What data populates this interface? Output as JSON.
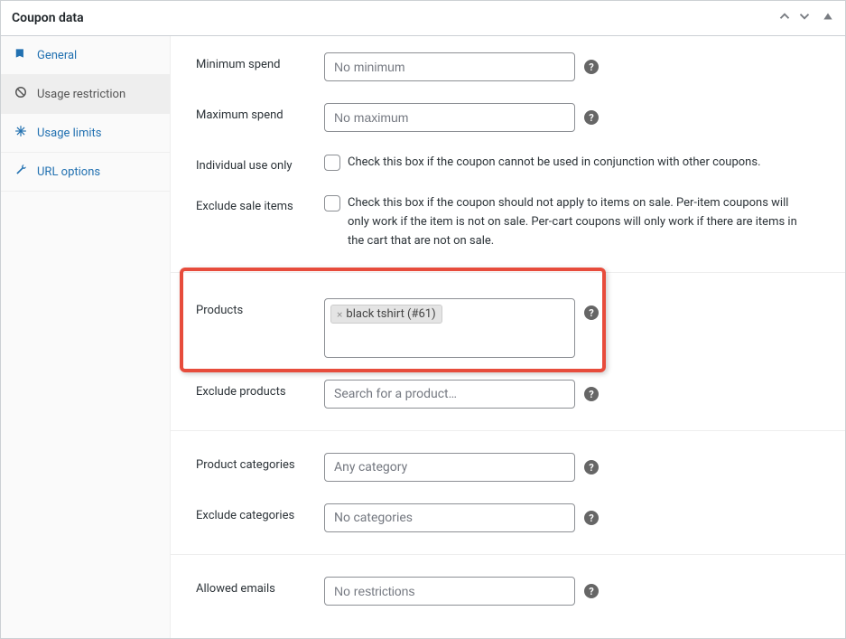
{
  "header": {
    "title": "Coupon data"
  },
  "tabs": [
    {
      "label": "General",
      "icon": "bookmark"
    },
    {
      "label": "Usage restriction",
      "icon": "ban"
    },
    {
      "label": "Usage limits",
      "icon": "spark"
    },
    {
      "label": "URL options",
      "icon": "wrench"
    }
  ],
  "fields": {
    "minSpend": {
      "label": "Minimum spend",
      "placeholder": "No minimum"
    },
    "maxSpend": {
      "label": "Maximum spend",
      "placeholder": "No maximum"
    },
    "individual": {
      "label": "Individual use only",
      "desc": "Check this box if the coupon cannot be used in conjunction with other coupons."
    },
    "excludeSale": {
      "label": "Exclude sale items",
      "desc": "Check this box if the coupon should not apply to items on sale. Per-item coupons will only work if the item is not on sale. Per-cart coupons will only work if there are items in the cart that are not on sale."
    },
    "products": {
      "label": "Products",
      "tag": "black tshirt (#61)"
    },
    "excludeProducts": {
      "label": "Exclude products",
      "placeholder": "Search for a product…"
    },
    "productCategories": {
      "label": "Product categories",
      "placeholder": "Any category"
    },
    "excludeCategories": {
      "label": "Exclude categories",
      "placeholder": "No categories"
    },
    "allowedEmails": {
      "label": "Allowed emails",
      "placeholder": "No restrictions"
    }
  }
}
